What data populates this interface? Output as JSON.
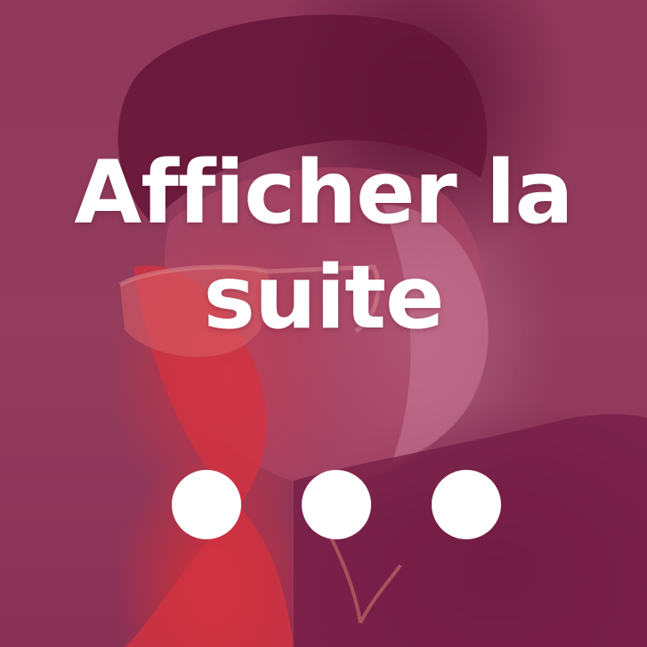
{
  "card": {
    "label": "Afficher la suite",
    "more_icon": "ellipsis-icon"
  },
  "colors": {
    "tint": "#8a3355",
    "text": "#ffffff"
  }
}
